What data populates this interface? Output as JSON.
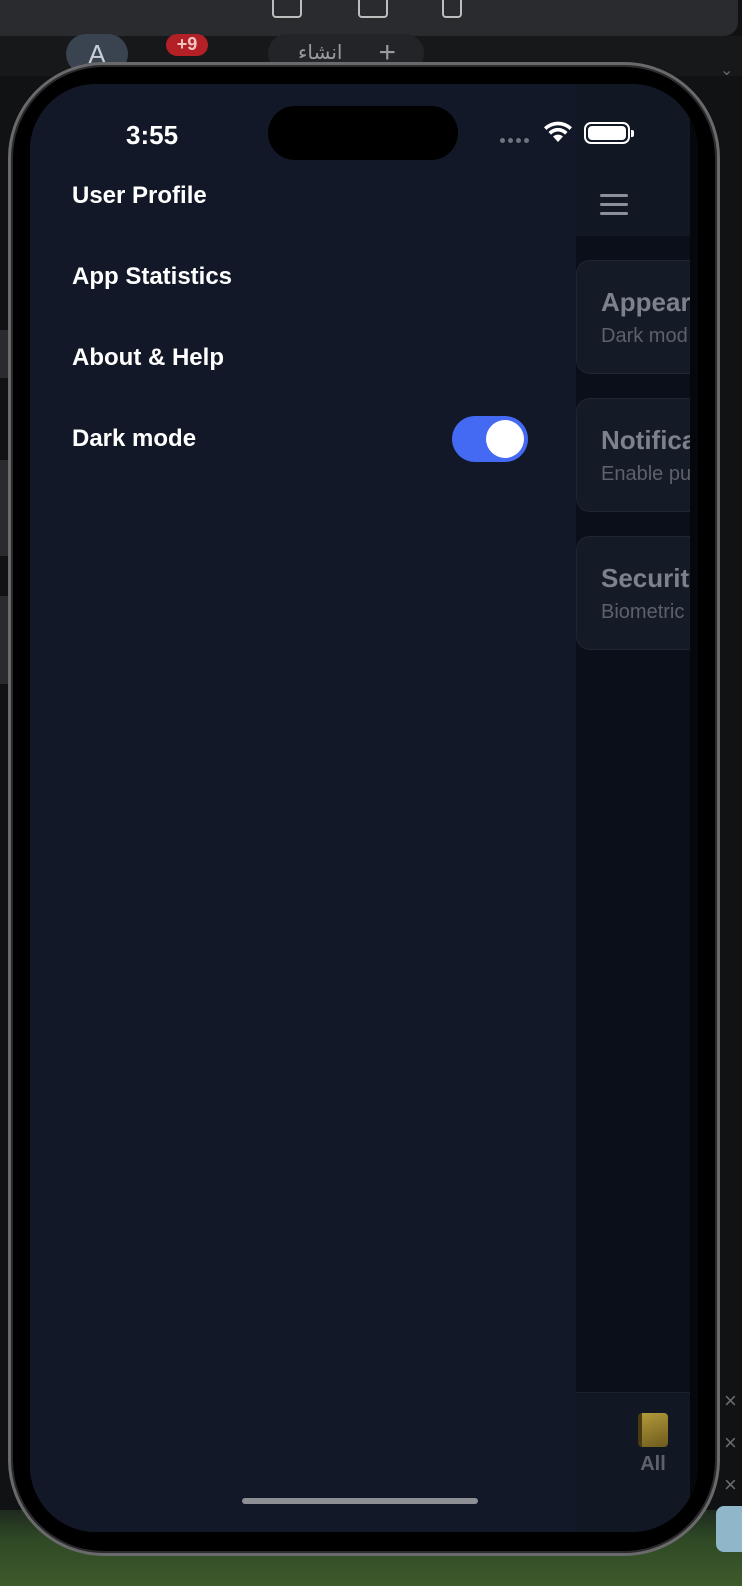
{
  "host": {
    "avatar_letter": "A",
    "notification_badge": "+9",
    "create_button_label": "انشاء"
  },
  "status_bar": {
    "time": "3:55"
  },
  "drawer": {
    "items": [
      {
        "label": "User Profile"
      },
      {
        "label": "App Statistics"
      },
      {
        "label": "About & Help"
      }
    ],
    "dark_mode": {
      "label": "Dark mode",
      "enabled": true
    }
  },
  "settings_cards": [
    {
      "title": "Appeara",
      "subtitle": "Dark mod"
    },
    {
      "title": "Notifica",
      "subtitle": "Enable pu"
    },
    {
      "title": "Security",
      "subtitle": "Biometric"
    }
  ],
  "bottom_tab": {
    "label": "All"
  },
  "colors": {
    "drawer_bg": "#121827",
    "toggle_on": "#4469f2",
    "app_bg": "#0b0f19"
  }
}
